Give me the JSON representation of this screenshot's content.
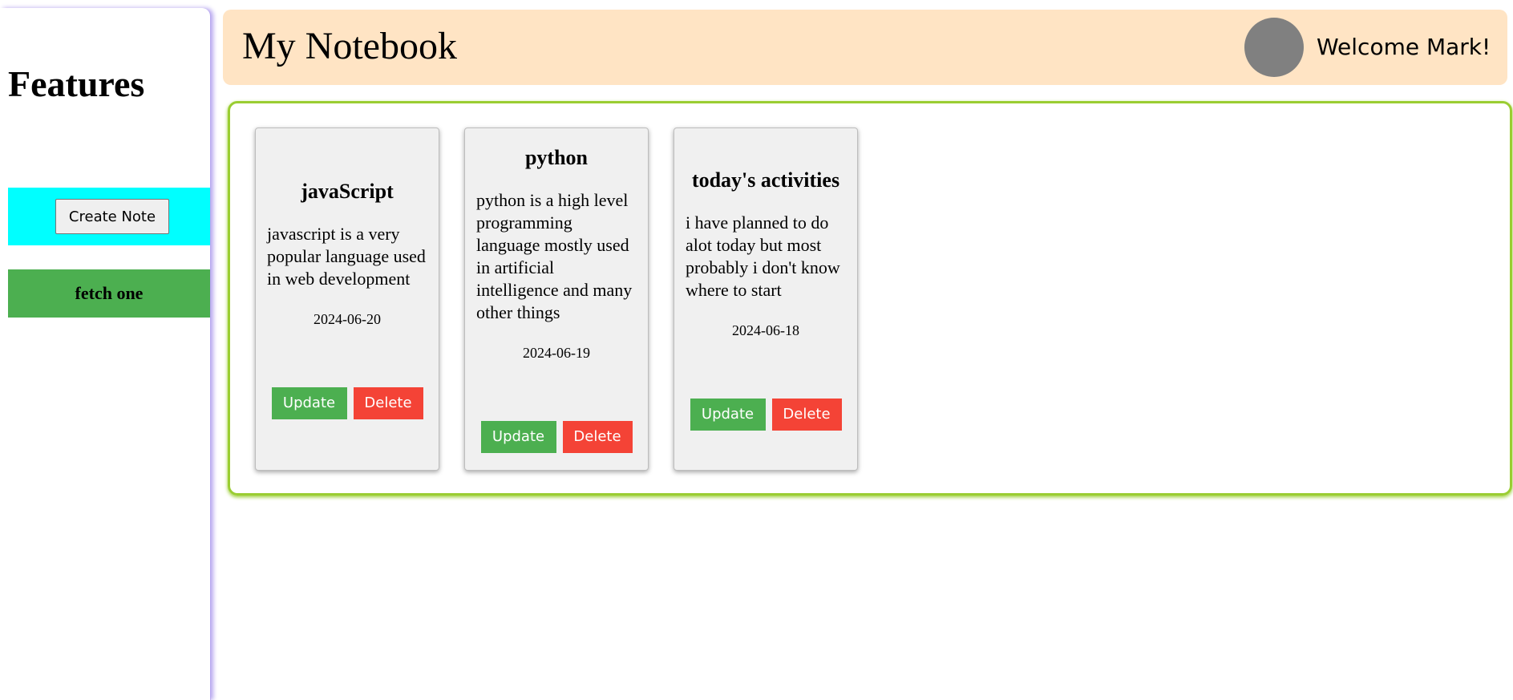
{
  "sidebar": {
    "title": "Features",
    "create_button": "Create Note",
    "fetch_label": "fetch one",
    "create_band_color": "#00ffff",
    "fetch_band_color": "#4caf50"
  },
  "header": {
    "title": "My Notebook",
    "welcome": "Welcome Mark!",
    "background_color": "#ffe4c4"
  },
  "notes": [
    {
      "title": "javaScript",
      "body": "javascript is a very popular language used in web development",
      "date": "2024-06-20",
      "update_label": "Update",
      "delete_label": "Delete"
    },
    {
      "title": "python",
      "body": "python is a high level programming language mostly used in artificial intelligence and many other things",
      "date": "2024-06-19",
      "update_label": "Update",
      "delete_label": "Delete"
    },
    {
      "title": "today's activities",
      "body": "i have planned to do alot today but most probably i don't know where to start",
      "date": "2024-06-18",
      "update_label": "Update",
      "delete_label": "Delete"
    }
  ],
  "colors": {
    "update_button": "#4caf50",
    "delete_button": "#f44336",
    "notes_border": "#9acd32",
    "avatar": "#808080"
  }
}
